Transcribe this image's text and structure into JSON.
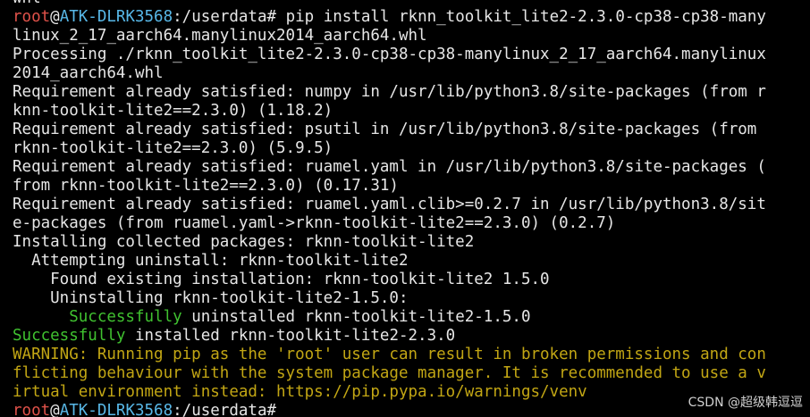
{
  "colors": {
    "background": "#000000",
    "text": "#e6e6e6",
    "prompt_user": "#e0524a",
    "prompt_host": "#58b8e8",
    "success": "#40c230",
    "warning": "#c2a614"
  },
  "terminal": {
    "lines": [
      [
        {
          "t": "whl",
          "c": "white"
        }
      ],
      [
        {
          "t": "root",
          "c": "red"
        },
        {
          "t": "@",
          "c": "white"
        },
        {
          "t": "ATK-DLRK3568",
          "c": "cyan"
        },
        {
          "t": ":/userdata# pip install rknn_toolkit_lite2-2.3.0-cp38-cp38-many",
          "c": "white"
        }
      ],
      [
        {
          "t": "linux_2_17_aarch64.manylinux2014_aarch64.whl",
          "c": "white"
        }
      ],
      [
        {
          "t": "Processing ./rknn_toolkit_lite2-2.3.0-cp38-cp38-manylinux_2_17_aarch64.manylinux",
          "c": "white"
        }
      ],
      [
        {
          "t": "2014_aarch64.whl",
          "c": "white"
        }
      ],
      [
        {
          "t": "Requirement already satisfied: numpy in /usr/lib/python3.8/site-packages (from r",
          "c": "white"
        }
      ],
      [
        {
          "t": "knn-toolkit-lite2==2.3.0) (1.18.2)",
          "c": "white"
        }
      ],
      [
        {
          "t": "Requirement already satisfied: psutil in /usr/lib/python3.8/site-packages (from",
          "c": "white"
        }
      ],
      [
        {
          "t": "rknn-toolkit-lite2==2.3.0) (5.9.5)",
          "c": "white"
        }
      ],
      [
        {
          "t": "Requirement already satisfied: ruamel.yaml in /usr/lib/python3.8/site-packages (",
          "c": "white"
        }
      ],
      [
        {
          "t": "from rknn-toolkit-lite2==2.3.0) (0.17.31)",
          "c": "white"
        }
      ],
      [
        {
          "t": "Requirement already satisfied: ruamel.yaml.clib>=0.2.7 in /usr/lib/python3.8/sit",
          "c": "white"
        }
      ],
      [
        {
          "t": "e-packages (from ruamel.yaml->rknn-toolkit-lite2==2.3.0) (0.2.7)",
          "c": "white"
        }
      ],
      [
        {
          "t": "Installing collected packages: rknn-toolkit-lite2",
          "c": "white"
        }
      ],
      [
        {
          "t": "  Attempting uninstall: rknn-toolkit-lite2",
          "c": "white"
        }
      ],
      [
        {
          "t": "    Found existing installation: rknn-toolkit-lite2 1.5.0",
          "c": "white"
        }
      ],
      [
        {
          "t": "    Uninstalling rknn-toolkit-lite2-1.5.0:",
          "c": "white"
        }
      ],
      [
        {
          "t": "      ",
          "c": "white"
        },
        {
          "t": "Successfully",
          "c": "green"
        },
        {
          "t": " uninstalled rknn-toolkit-lite2-1.5.0",
          "c": "white"
        }
      ],
      [
        {
          "t": "Successfully",
          "c": "green"
        },
        {
          "t": " installed rknn-toolkit-lite2-2.3.0",
          "c": "white"
        }
      ],
      [
        {
          "t": "WARNING: Running pip as the 'root' user can result in broken permissions and con",
          "c": "yellow"
        }
      ],
      [
        {
          "t": "flicting behaviour with the system package manager. It is recommended to use a v",
          "c": "yellow"
        }
      ],
      [
        {
          "t": "irtual environment instead: https://pip.pypa.io/warnings/venv",
          "c": "yellow"
        }
      ],
      [
        {
          "t": "root",
          "c": "red"
        },
        {
          "t": "@",
          "c": "white"
        },
        {
          "t": "ATK-DLRK3568",
          "c": "cyan"
        },
        {
          "t": ":/userdata#",
          "c": "white"
        }
      ]
    ]
  },
  "watermark": {
    "text": "CSDN @超级韩逗逗"
  }
}
